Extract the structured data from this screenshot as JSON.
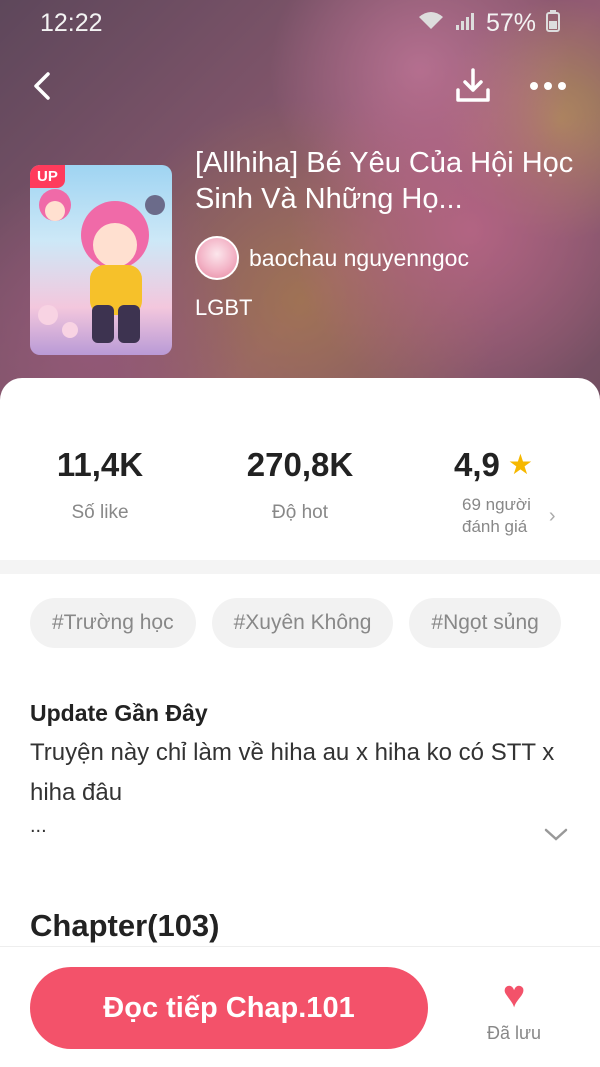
{
  "status": {
    "time": "12:22",
    "battery": "57%"
  },
  "header": {
    "title": "[Allhiha] Bé Yêu Của Hội Học Sinh Và Những Họ...",
    "author": "baochau nguyenngoc",
    "genre": "LGBT",
    "cover_badge": "UP"
  },
  "stats": {
    "likes": {
      "value": "11,4K",
      "label": "Số like"
    },
    "hot": {
      "value": "270,8K",
      "label": "Độ hot"
    },
    "rating": {
      "value": "4,9",
      "label_line1": "69 người",
      "label_line2": "đánh giá"
    }
  },
  "tags": [
    "#Trường học",
    "#Xuyên Không",
    "#Ngọt sủng"
  ],
  "update": {
    "title": "Update Gần Đây",
    "text": "Truyện này chỉ làm về hiha au x hiha ko có STT x hiha đâu",
    "ellipsis": "..."
  },
  "chapters": {
    "title": "Chapter(103)"
  },
  "bottom": {
    "read_label": "Đọc tiếp Chap.101",
    "save_label": "Đã lưu"
  },
  "colors": {
    "accent": "#f3526a",
    "star": "#f6b800"
  },
  "icons": [
    "back-icon",
    "download-icon",
    "more-icon",
    "star-icon",
    "chevron-right-icon",
    "chevron-down-icon",
    "heart-icon",
    "wifi-icon",
    "signal-icon",
    "battery-icon"
  ]
}
